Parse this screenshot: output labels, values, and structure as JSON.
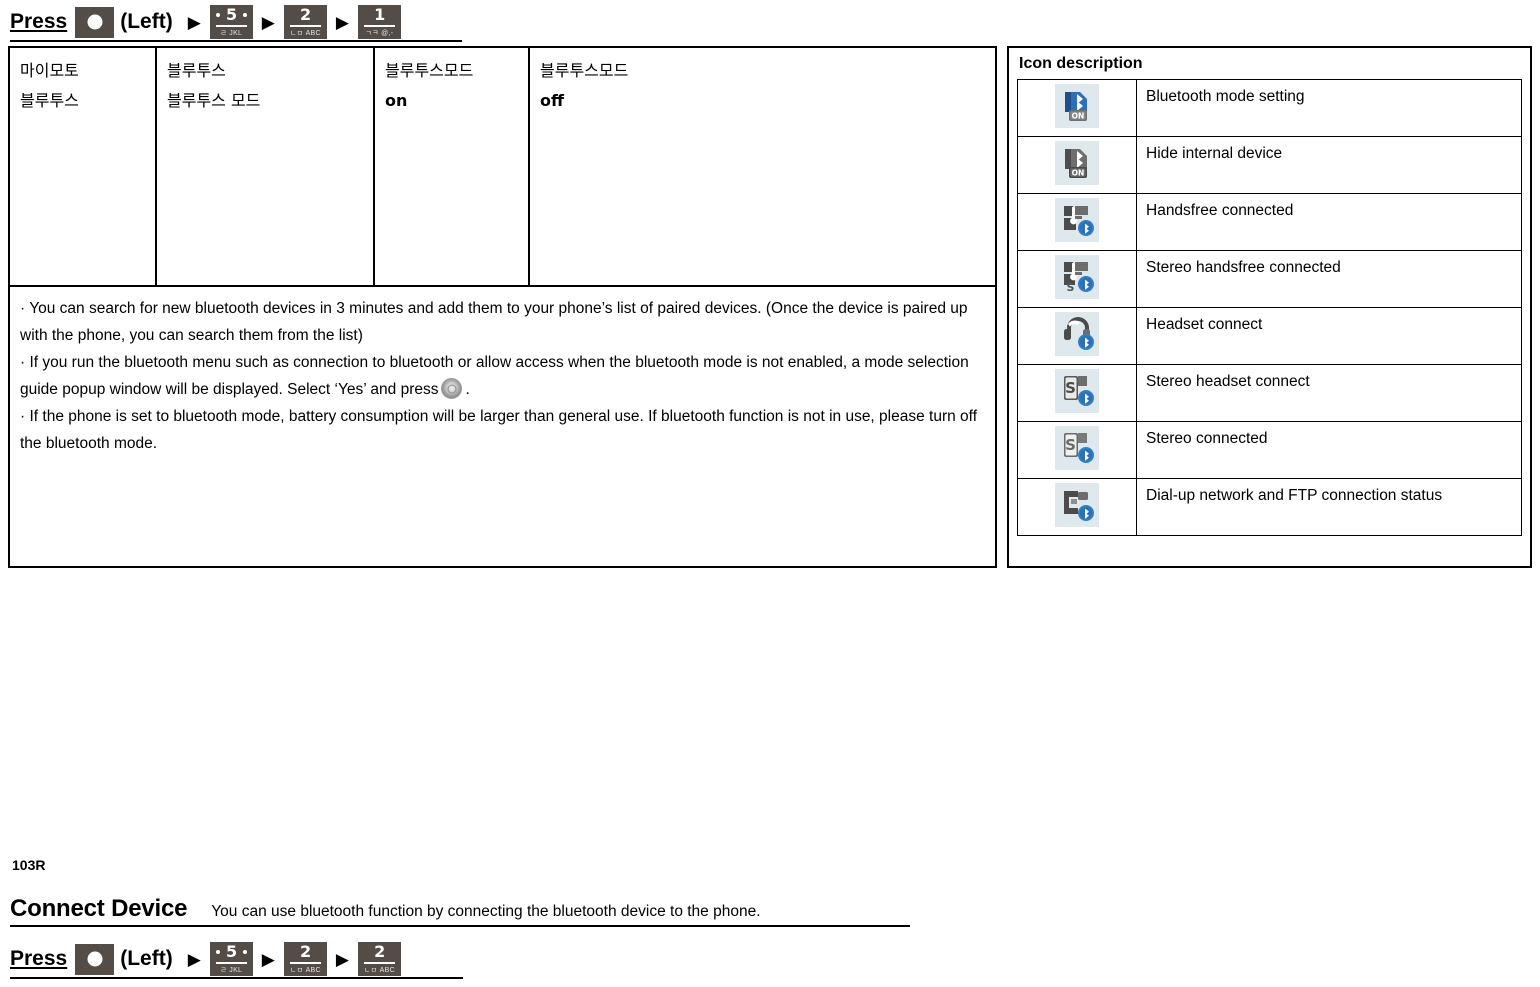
{
  "top_press_line": {
    "press_label": "Press",
    "left_label": "(Left)",
    "arrow": "▶",
    "keys": [
      {
        "name": "ok-key",
        "num": "",
        "sub": "",
        "type": "ok"
      },
      {
        "name": "key-5",
        "num": "5",
        "sub": "ㄹ JKL",
        "type": "num",
        "dots": true
      },
      {
        "name": "key-2",
        "num": "2",
        "sub": "ㄴㅁ ABC",
        "type": "num",
        "dots": false
      },
      {
        "name": "key-1",
        "num": "1",
        "sub": "ㄱㅋ @,-",
        "type": "num",
        "dots": false
      }
    ]
  },
  "menu_table": {
    "columns": [
      {
        "line1": "마이모토",
        "line2": "블루투스",
        "line2_bold": false
      },
      {
        "line1": "블루투스",
        "line2": "블루투스 모드",
        "line2_bold": false
      },
      {
        "line1": "블루투스모드",
        "line2": "on",
        "line2_bold": true
      },
      {
        "line1": "블루투스모드",
        "line2": "off",
        "line2_bold": true
      }
    ],
    "notes": {
      "note1": "· You can search for new bluetooth devices in 3 minutes and add them to your phone’s list of paired devices. (Once the device is paired up with the phone, you can search them from the list)",
      "note2_a": "· If you run the bluetooth menu such as connection to bluetooth or allow access when the bluetooth mode is not enabled, a mode selection guide popup window will be displayed. Select ‘Yes’ and press",
      "note2_b": ".",
      "note3": "· If the phone is set to bluetooth mode, battery consumption will be larger than general use. If bluetooth function is not in use, please turn off the bluetooth mode."
    }
  },
  "icon_panel": {
    "title": "Icon description",
    "rows": [
      {
        "icon": "bluetooth-mode-setting-icon",
        "label": "Bluetooth mode setting",
        "style": "blue-on"
      },
      {
        "icon": "hide-internal-device-icon",
        "label": "Hide internal device",
        "style": "gray-on"
      },
      {
        "icon": "handsfree-connected-icon",
        "label": "Handsfree connected",
        "style": "handsfree"
      },
      {
        "icon": "stereo-handsfree-connected-icon",
        "label": "Stereo handsfree connected",
        "style": "stereo-handsfree"
      },
      {
        "icon": "headset-connect-icon",
        "label": "Headset connect",
        "style": "headset"
      },
      {
        "icon": "stereo-headset-connect-icon",
        "label": "Stereo headset connect",
        "style": "stereo-headset"
      },
      {
        "icon": "stereo-connected-icon",
        "label": "Stereo connected",
        "style": "stereo"
      },
      {
        "icon": "dialup-ftp-status-icon",
        "label": "Dial-up network and FTP connection status",
        "style": "dialup"
      }
    ]
  },
  "bottom": {
    "page_code": "103R",
    "section_title": "Connect Device",
    "section_subtitle": "You can use bluetooth function by connecting the bluetooth device to the phone.",
    "press_line": {
      "press_label": "Press",
      "left_label": "(Left)",
      "arrow": "▶",
      "keys": [
        {
          "name": "ok-key",
          "num": "",
          "sub": "",
          "type": "ok"
        },
        {
          "name": "key-5",
          "num": "5",
          "sub": "ㄹ JKL",
          "type": "num",
          "dots": true
        },
        {
          "name": "key-2",
          "num": "2",
          "sub": "ㄴㅁ ABC",
          "type": "num",
          "dots": false
        },
        {
          "name": "key-2b",
          "num": "2",
          "sub": "ㄴㅁ ABC",
          "type": "num",
          "dots": false
        }
      ]
    }
  },
  "colors": {
    "key_tile": "#534c47",
    "icon_bg": "#dfe8ec",
    "bluetooth_blue": "#2f6fb5"
  }
}
